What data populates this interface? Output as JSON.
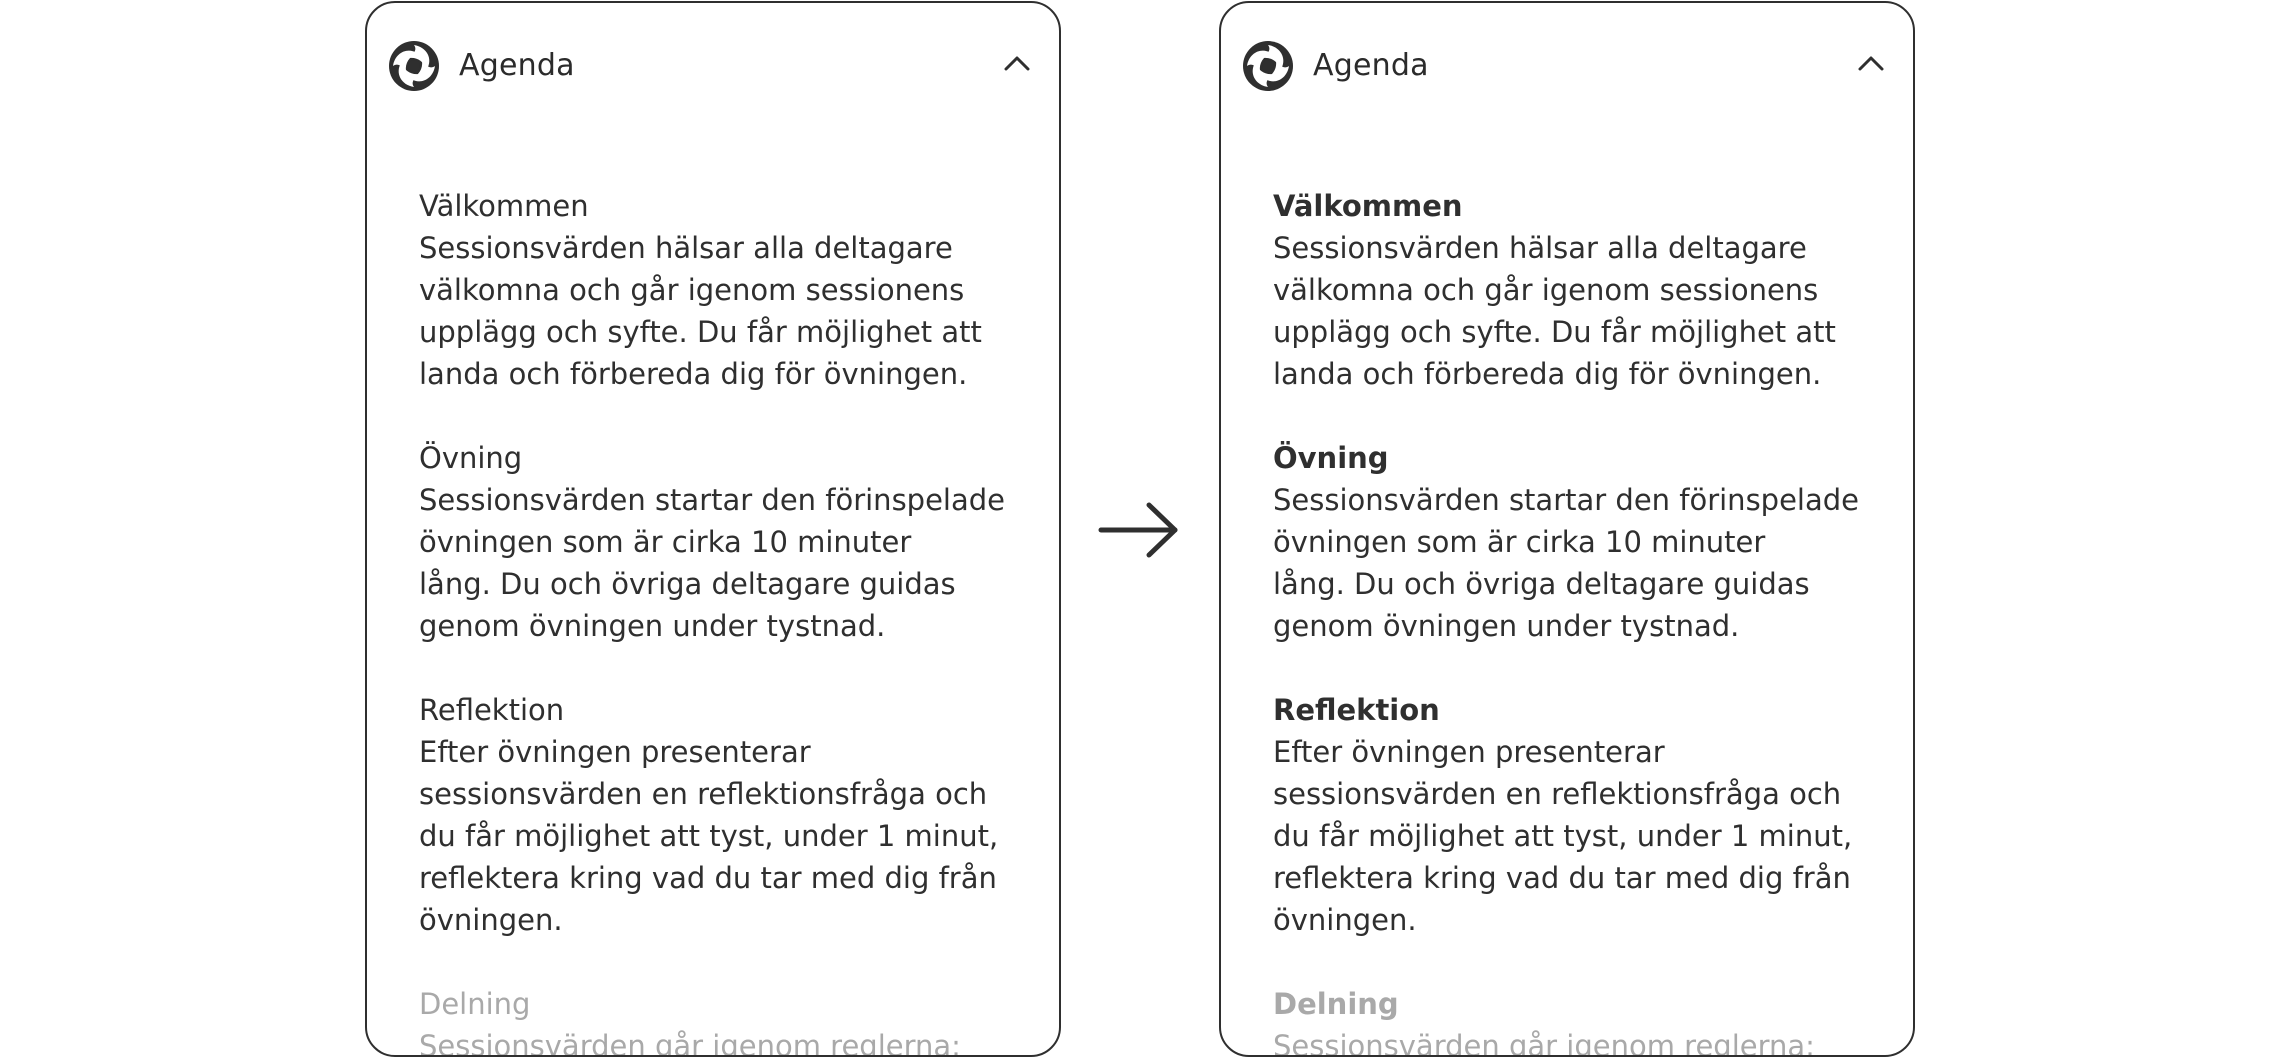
{
  "header": {
    "title": "Agenda",
    "logo_icon": "swirl-logo-icon",
    "collapse_icon": "chevron-up-icon"
  },
  "arrow_icon": "arrow-right-icon",
  "sections": [
    {
      "title": "Välkommen",
      "lines": [
        "Sessionsvärden hälsar alla deltagare",
        "välkomna och går igenom sessionens",
        "upplägg och syfte. Du får möjlighet att",
        "landa och förbereda dig för övningen."
      ]
    },
    {
      "title": "Övning",
      "lines": [
        "Sessionsvärden startar den förinspelade",
        "övningen som är cirka 10 minuter",
        "lång. Du och övriga deltagare guidas",
        "genom övningen under tystnad."
      ]
    },
    {
      "title": "Reflektion",
      "lines": [
        "Efter övningen presenterar",
        "sessionsvärden en reflektionsfråga och",
        "du får möjlighet att tyst, under 1 minut,",
        "reflektera kring vad du tar med dig från",
        "övningen."
      ]
    },
    {
      "title": "Delning",
      "lines": [
        "Sessionsvärden går igenom reglerna:"
      ]
    }
  ]
}
